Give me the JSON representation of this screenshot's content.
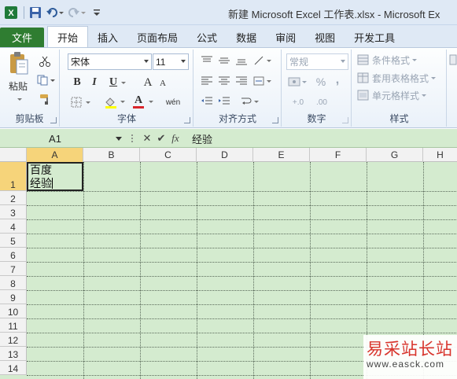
{
  "window": {
    "title": "新建 Microsoft Excel 工作表.xlsx  -  Microsoft Ex"
  },
  "tabs": [
    {
      "label": "文件"
    },
    {
      "label": "开始"
    },
    {
      "label": "插入"
    },
    {
      "label": "页面布局"
    },
    {
      "label": "公式"
    },
    {
      "label": "数据"
    },
    {
      "label": "审阅"
    },
    {
      "label": "视图"
    },
    {
      "label": "开发工具"
    }
  ],
  "ribbon": {
    "clipboard": {
      "label": "剪贴板",
      "paste": "粘贴"
    },
    "font": {
      "label": "字体",
      "name": "宋体",
      "size": "11",
      "bold": "B",
      "italic": "I",
      "underline": "U",
      "grow": "A",
      "shrink": "A",
      "color": "A",
      "phonetic": "wén"
    },
    "alignment": {
      "label": "对齐方式"
    },
    "number": {
      "label": "数字",
      "format": "常规",
      "percent": "%",
      "comma": ",",
      "inc_decimal": "+.0",
      "dec_decimal": ".00"
    },
    "styles": {
      "label": "样式",
      "conditional": "条件格式",
      "table_format": "套用表格格式",
      "cell_styles": "单元格样式"
    }
  },
  "formula_bar": {
    "name_box": "A1",
    "cancel": "✕",
    "enter": "✔",
    "fx": "fx",
    "value": "经验"
  },
  "grid": {
    "columns": [
      "A",
      "B",
      "C",
      "D",
      "E",
      "F",
      "G",
      "H"
    ],
    "rows": [
      "1",
      "2",
      "3",
      "4",
      "5",
      "6",
      "7",
      "8",
      "9",
      "10",
      "11",
      "12",
      "13",
      "14"
    ],
    "cell_a1": {
      "line1": "百度",
      "line2": "经验"
    }
  },
  "watermark": {
    "title": "易采站长站",
    "url": "www.easck.com"
  },
  "colors": {
    "file_tab": "#2f7d31",
    "grid_bg": "#d4ebcf",
    "selected_header": "#f6d47a",
    "watermark": "#d8342c"
  }
}
